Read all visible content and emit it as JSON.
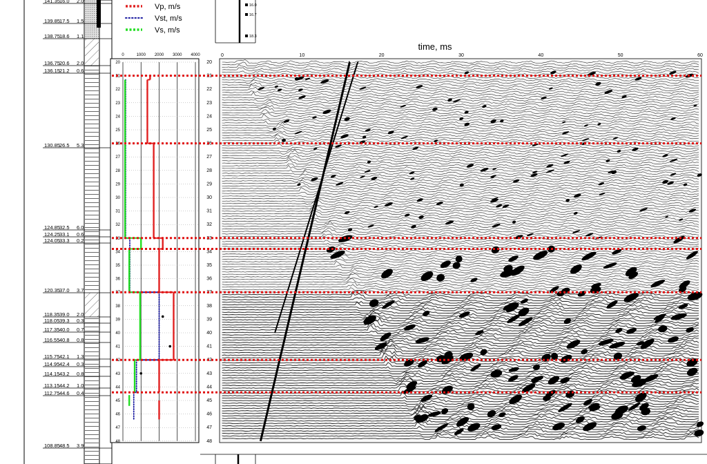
{
  "chart_data": [
    {
      "type": "table",
      "name_hint": "borehole-log",
      "rows": [
        {
          "elev": "141.35",
          "depth": "16.0",
          "thick": "2.0"
        },
        {
          "elev": "139.85",
          "depth": "17.5",
          "thick": "1.5"
        },
        {
          "elev": "138.75",
          "depth": "18.6",
          "thick": "1.1"
        },
        {
          "elev": "136.75",
          "depth": "20.6",
          "thick": "2.0"
        },
        {
          "elev": "136.15",
          "depth": "21.2",
          "thick": "0.6"
        },
        {
          "elev": "130.85",
          "depth": "26.5",
          "thick": "5.3"
        },
        {
          "elev": "124.85",
          "depth": "32.5",
          "thick": "6.0"
        },
        {
          "elev": "124.25",
          "depth": "33.1",
          "thick": "0.6"
        },
        {
          "elev": "124.05",
          "depth": "33.3",
          "thick": "0.2"
        },
        {
          "elev": "120.35",
          "depth": "37.0",
          "thick": "3.7"
        },
        {
          "elev": "118.35",
          "depth": "39.0",
          "thick": "2.0"
        },
        {
          "elev": "118.05",
          "depth": "39.3",
          "thick": "0.3"
        },
        {
          "elev": "117.35",
          "depth": "40.0",
          "thick": "0.7"
        },
        {
          "elev": "116.55",
          "depth": "40.8",
          "thick": "0.8"
        },
        {
          "elev": "115.75",
          "depth": "42.1",
          "thick": "1.3"
        },
        {
          "elev": "114.95",
          "depth": "42.4",
          "thick": "0.3"
        },
        {
          "elev": "114.15",
          "depth": "43.2",
          "thick": "0.8"
        },
        {
          "elev": "113.15",
          "depth": "44.2",
          "thick": "1.0"
        },
        {
          "elev": "112.75",
          "depth": "44.6",
          "thick": "0.4"
        },
        {
          "elev": "108.85",
          "depth": "48.5",
          "thick": "3.9"
        }
      ]
    },
    {
      "type": "line",
      "legend": [
        {
          "label": "Vp, m/s",
          "color": "#e02020",
          "style": "dotted-square"
        },
        {
          "label": "Vst, m/s",
          "color": "#1a1aa0",
          "style": "dotted-round"
        },
        {
          "label": "Vs, m/s",
          "color": "#22dd22",
          "style": "dotted-square"
        }
      ],
      "x_ticks": [
        "0",
        "1000",
        "2000",
        "3000",
        "4000"
      ],
      "xlim": [
        0,
        4000
      ],
      "y_ticks": [
        "20",
        "21",
        "22",
        "23",
        "24",
        "25",
        "26",
        "27",
        "28",
        "29",
        "30",
        "31",
        "32",
        "33",
        "34",
        "35",
        "36",
        "37",
        "38",
        "39",
        "40",
        "41",
        "42",
        "43",
        "44",
        "45",
        "46",
        "47",
        "48"
      ],
      "ylim": [
        20,
        48
      ],
      "series": [
        {
          "name": "Vp, m/s",
          "steps": [
            {
              "from": 21.0,
              "to": 21.3,
              "v": 1500
            },
            {
              "from": 21.3,
              "to": 26.0,
              "v": 1350
            },
            {
              "from": 26.0,
              "to": 33.0,
              "v": 1700
            },
            {
              "from": 33.0,
              "to": 33.8,
              "v": 2200
            },
            {
              "from": 33.8,
              "to": 37.0,
              "v": 2000
            },
            {
              "from": 37.0,
              "to": 42.0,
              "v": 2800
            },
            {
              "from": 42.0,
              "to": 44.4,
              "v": 2000
            },
            {
              "from": 45.0,
              "to": 46.4,
              "v": 2000
            }
          ]
        },
        {
          "name": "Vst, m/s",
          "steps": [
            {
              "from": 21.3,
              "to": 33.0,
              "v": 150
            },
            {
              "from": 33.0,
              "to": 37.0,
              "v": 380
            },
            {
              "from": 37.0,
              "to": 42.0,
              "v": 2000
            },
            {
              "from": 42.0,
              "to": 44.4,
              "v": 750
            },
            {
              "from": 44.4,
              "to": 46.4,
              "v": 600
            }
          ]
        },
        {
          "name": "Vs, m/s",
          "steps": [
            {
              "from": 21.3,
              "to": 33.0,
              "v": 120
            },
            {
              "from": 33.0,
              "to": 33.8,
              "v": 1000
            },
            {
              "from": 33.8,
              "to": 37.0,
              "v": 350
            },
            {
              "from": 37.0,
              "to": 42.0,
              "v": 950
            },
            {
              "from": 42.0,
              "to": 44.4,
              "v": 650
            },
            {
              "from": 44.6,
              "to": 45.4,
              "v": 350
            }
          ]
        }
      ],
      "points": [
        {
          "depth": 38.8,
          "v": 2200
        },
        {
          "depth": 41.0,
          "v": 2600
        },
        {
          "depth": 43.0,
          "v": 1000
        }
      ]
    },
    {
      "type": "heatmap",
      "title": "time, ms",
      "x_ticks": [
        "0",
        "10",
        "20",
        "30",
        "40",
        "50",
        "60"
      ],
      "xlim": [
        0,
        60
      ],
      "y_ticks": [
        "20",
        "21",
        "22",
        "23",
        "24",
        "25",
        "26",
        "27",
        "28",
        "29",
        "30",
        "31",
        "32",
        "33",
        "34",
        "35",
        "36",
        "37",
        "38",
        "39",
        "40",
        "41",
        "42",
        "43",
        "44",
        "45",
        "46",
        "47",
        "48"
      ],
      "ylim": [
        20,
        48
      ],
      "note_markers": [
        "16.0",
        "16.7",
        "18.3"
      ]
    }
  ],
  "boundaries": [
    21.0,
    26.0,
    33.0,
    33.8,
    37.0,
    42.0,
    44.4
  ],
  "colors": {
    "vp": "#e02020",
    "vst": "#1a1aa0",
    "vs": "#22dd22",
    "boundary": "#e01010"
  }
}
